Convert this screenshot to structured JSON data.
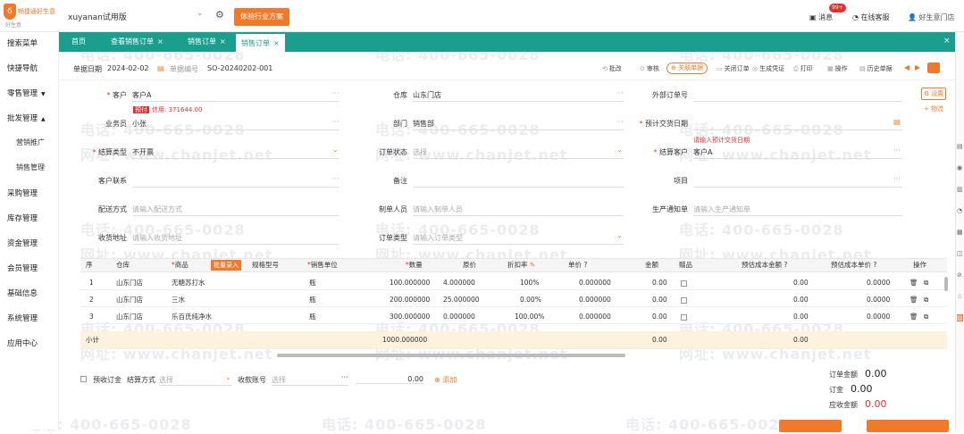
{
  "app": {
    "logo_text": "畅捷通好生意",
    "logo_sub": "好生意",
    "account": "xuyanan试用版",
    "trial_btn": "体验行业方案",
    "messages": "消息",
    "messages_badge": "99+",
    "online_service": "在线客服",
    "user": "好生意门店"
  },
  "sidebar": {
    "items": [
      {
        "label": "搜索菜单"
      },
      {
        "label": "快捷导航"
      },
      {
        "label": "零售管理",
        "arrow": "▼"
      },
      {
        "label": "批发管理",
        "arrow": "▲"
      },
      {
        "label": "营销推广",
        "sub": true
      },
      {
        "label": "销售管理",
        "sub": true
      },
      {
        "label": "采购管理"
      },
      {
        "label": "库存管理"
      },
      {
        "label": "资金管理"
      },
      {
        "label": "会员管理"
      },
      {
        "label": "基础信息"
      },
      {
        "label": "系统管理"
      },
      {
        "label": "应用中心"
      }
    ]
  },
  "tabs": [
    {
      "label": "首页"
    },
    {
      "label": "查看销售订单",
      "close": "×"
    },
    {
      "label": "销售订单",
      "close": "×"
    },
    {
      "label": "销售订单",
      "close": "×",
      "active": true
    }
  ],
  "tab_controls": {
    "close_all": "×",
    "expand": "□"
  },
  "header": {
    "date_label": "单据日期",
    "date_value": "2024-02-02",
    "number_label": "单据编号",
    "number_value": "SO-20240202-001",
    "toolbar": [
      "批改",
      "审核",
      "关闭订单",
      "生成凭证",
      "打印",
      "操作",
      "历史单据"
    ],
    "highlight_btn": "关联单据"
  },
  "form": {
    "customer_label": "客户",
    "customer_value": "客户A",
    "credit_tag": "预付",
    "credit_text": "信用: 371644.00",
    "salesperson_label": "业务员",
    "salesperson_value": "小张",
    "settle_label": "结算类型",
    "settle_value": "不开票",
    "contact_label": "客户联系",
    "delivery_label": "配送方式",
    "delivery_ph": "请输入配送方式",
    "address_label": "收货地址",
    "address_ph": "请输入收货地址",
    "warehouse_label": "仓库",
    "warehouse_value": "山东门店",
    "dept_label": "部门",
    "dept_value": "销售部",
    "order_status_label": "订单状态",
    "order_status_value": "选择",
    "remark_label": "备注",
    "maker_label": "制单人员",
    "maker_ph": "请输入制单人员",
    "order_type_label": "订单类型",
    "order_type_value": "请输入订单类型",
    "ext_label": "外部订单号",
    "delivery_date_label": "预计交货日期",
    "contract_label": "结算客户",
    "contract_value": "客户A",
    "contract_link": "请输入预计交货日期",
    "project_label": "项目",
    "production_label": "生产通知单",
    "production_ph": "请输入生产通知单",
    "side_btn1": "设置",
    "side_btn2": "+ 物流"
  },
  "grid": {
    "headers": [
      "序",
      "仓库",
      "商品",
      "批量录入",
      "规格型号",
      "销售单位",
      "数量",
      "原价",
      "折扣率",
      "单价",
      "金额",
      "赠品",
      "预估成本金额",
      "预估成本单价",
      "操作"
    ],
    "rows": [
      {
        "no": "1",
        "warehouse": "山东门店",
        "product": "无糖苏打水",
        "unit": "瓶",
        "qty": "100.000000",
        "price": "4.000000",
        "discount": "100%",
        "unit_price": "0.000000",
        "amount": "0.00",
        "cost": "0.00",
        "cost_price": "0.0000"
      },
      {
        "no": "2",
        "warehouse": "山东门店",
        "product": "三水",
        "unit": "瓶",
        "qty": "200.000000",
        "price": "25.000000",
        "discount": "0.00%",
        "unit_price": "0.000000",
        "amount": "0.00",
        "cost": "0.00",
        "cost_price": "0.0000"
      },
      {
        "no": "3",
        "warehouse": "山东门店",
        "product": "乐百氏纯净水",
        "unit": "瓶",
        "qty": "300.000000",
        "price": "0.000000",
        "discount": "100.00%",
        "unit_price": "0.000000",
        "amount": "0.00",
        "cost": "0.00",
        "cost_price": "0.0000"
      }
    ],
    "subtotal_label": "小计",
    "subtotal_qty": "1000.000000",
    "subtotal_amount": "0.00",
    "subtotal_cost": "0.00"
  },
  "footer": {
    "prepay_label": "预收订金",
    "method_label": "结算方式",
    "method_ph": "选择",
    "account_label": "收款账号",
    "account_ph": "选择",
    "amount_value": "0.00",
    "add_label": "添加",
    "order_amount_label": "订单金额",
    "order_amount": "0.00",
    "deposit_label": "订金",
    "deposit": "0.00",
    "payable_label": "应收金额",
    "payable": "0.00"
  },
  "watermark": {
    "phone": "电话: 400-665-0028",
    "web": "网址: www.chanjet.net"
  },
  "colors": {
    "brand": "#f07a2a",
    "tab": "#1a9e8e",
    "danger": "#e03030"
  }
}
